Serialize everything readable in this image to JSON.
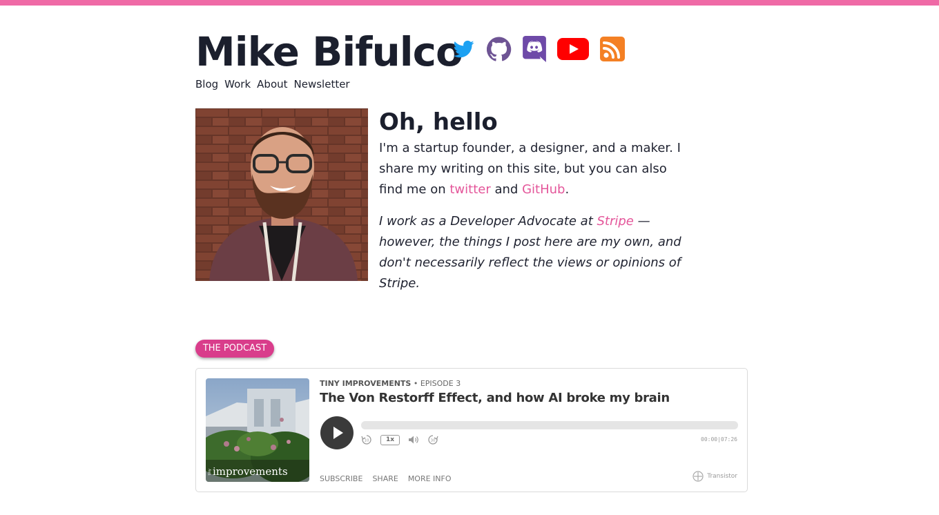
{
  "site": {
    "title": "Mike Bifulco"
  },
  "social": [
    {
      "name": "twitter",
      "color": "#1da1f2"
    },
    {
      "name": "github",
      "color": "#6e5494"
    },
    {
      "name": "discord",
      "color": "#6e4aa8"
    },
    {
      "name": "youtube",
      "color": "#ff0000"
    },
    {
      "name": "rss",
      "color": "#f48024"
    }
  ],
  "nav": {
    "blog": "Blog",
    "work": "Work",
    "about": "About",
    "newsletter": "Newsletter"
  },
  "intro": {
    "heading": "Oh, hello",
    "p1_a": "I'm a startup founder, a designer, and a maker. I share my writing on this site, but you can also find me on ",
    "twitter_link": "twitter",
    "p1_b": " and ",
    "github_link": "GitHub",
    "p1_c": ".",
    "p2_a": "I work as a Developer Advocate at ",
    "stripe_link": "Stripe",
    "p2_b": " — however, the things I post here are my own, and don't necessarily reflect the views or opinions of Stripe."
  },
  "podcast": {
    "pill": "THE PODCAST",
    "show": "TINY IMPROVEMENTS",
    "episode": " • EPISODE 3",
    "title": "The Von Restorff Effect, and how AI broke my brain",
    "cover_label": "improvements",
    "cover_small": "tiny",
    "speed": "1x",
    "time": "00:00|07:26",
    "progress": 0,
    "subscribe": "SUBSCRIBE",
    "share": "SHARE",
    "more_info": "MORE INFO",
    "brand": "Transistor"
  },
  "colors": {
    "accent": "#e4569a",
    "topbar": "#ef6aa6",
    "pill": "#d93d8b"
  }
}
